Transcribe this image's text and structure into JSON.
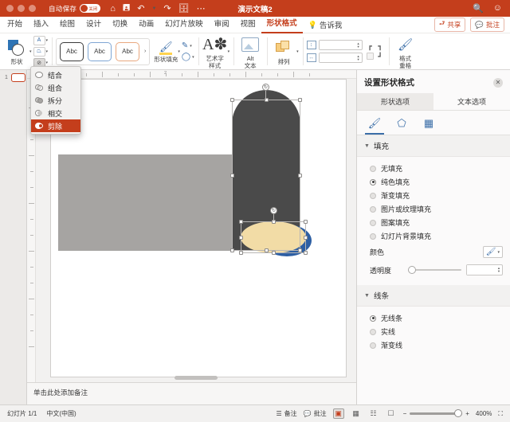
{
  "titlebar": {
    "autosave_label": "自动保存",
    "toggle_state": "关闭",
    "icons": [
      "home-icon",
      "save-icon",
      "undo-icon",
      "redo-icon",
      "print-icon",
      "more-icon"
    ],
    "document_title": "演示文稿2",
    "right_icons": [
      "search-icon",
      "account-icon"
    ]
  },
  "ribbon_tabs": {
    "items": [
      {
        "label": "开始"
      },
      {
        "label": "插入"
      },
      {
        "label": "绘图"
      },
      {
        "label": "设计"
      },
      {
        "label": "切换"
      },
      {
        "label": "动画"
      },
      {
        "label": "幻灯片放映"
      },
      {
        "label": "审阅"
      },
      {
        "label": "视图"
      },
      {
        "label": "形状格式"
      }
    ],
    "active": "形状格式",
    "tell_me": "告诉我",
    "share_label": "共享",
    "comments_label": "批注"
  },
  "ribbon": {
    "shapes_label": "形状",
    "text_box_icon": "A",
    "edit_points_icon": "edit-points",
    "merge_shapes_icon": "merge-shapes",
    "style_samples": [
      "Abc",
      "Abc",
      "Abc"
    ],
    "shape_fill_label": "形状填充",
    "wordart_label": "艺术字\n样式",
    "wordart_line1": "艺术字",
    "wordart_line2": "样式",
    "alt_text_line1": "Alt",
    "alt_text_line2": "文本",
    "arrange_label": "排列",
    "height_value": "",
    "width_value": "",
    "format_painter_line1": "格式",
    "format_painter_line2": "重格"
  },
  "merge_menu": {
    "items": [
      {
        "label": "结合",
        "icon": "union-icon",
        "selected": false
      },
      {
        "label": "组合",
        "icon": "combine-icon",
        "selected": false
      },
      {
        "label": "拆分",
        "icon": "fragment-icon",
        "selected": false
      },
      {
        "label": "相交",
        "icon": "intersect-icon",
        "selected": false
      },
      {
        "label": "剪除",
        "icon": "subtract-icon",
        "selected": true
      }
    ]
  },
  "thumbnails": {
    "slide_number": "1"
  },
  "ruler": {
    "h_numbers": [
      "4",
      "2"
    ],
    "v_numbers": [
      "4",
      "2"
    ]
  },
  "slide": {
    "shapes": [
      {
        "name": "gray-rectangle",
        "fill": "#a6a4a2"
      },
      {
        "name": "dark-rounded-shape",
        "fill": "#4a4a4a",
        "selected": true
      },
      {
        "name": "blue-ellipse",
        "fill": "#2e5fa3"
      },
      {
        "name": "tan-ellipse",
        "fill": "#f2dca6",
        "selected": true
      }
    ]
  },
  "notes": {
    "placeholder": "单击此处添加备注"
  },
  "format_pane": {
    "title": "设置形状格式",
    "tabs": [
      {
        "label": "形状选项",
        "active": true
      },
      {
        "label": "文本选项",
        "active": false
      }
    ],
    "icon_tabs": [
      "fill-bucket-icon",
      "pentagon-effects-icon",
      "size-properties-icon"
    ],
    "fill_section": {
      "title": "填充",
      "options": [
        {
          "label": "无填充",
          "selected": false
        },
        {
          "label": "纯色填充",
          "selected": true
        },
        {
          "label": "渐变填充",
          "selected": false
        },
        {
          "label": "图片或纹理填充",
          "selected": false
        },
        {
          "label": "图案填充",
          "selected": false
        },
        {
          "label": "幻灯片背景填充",
          "selected": false
        }
      ],
      "color_label": "颜色",
      "transparency_label": "透明度",
      "transparency_value": ""
    },
    "line_section": {
      "title": "线条",
      "options": [
        {
          "label": "无线条",
          "selected": true
        },
        {
          "label": "实线",
          "selected": false
        },
        {
          "label": "渐变线",
          "selected": false
        }
      ]
    }
  },
  "status": {
    "slide_count": "幻灯片 1/1",
    "language": "中文(中国)",
    "notes_label": "备注",
    "comments_label": "批注",
    "views": [
      "normal-view-icon",
      "slide-sorter-icon",
      "reading-view-icon",
      "slideshow-icon"
    ],
    "zoom_out": "−",
    "zoom_in": "+",
    "zoom_level": "400%",
    "fit_icon": "fit-slide-icon"
  }
}
